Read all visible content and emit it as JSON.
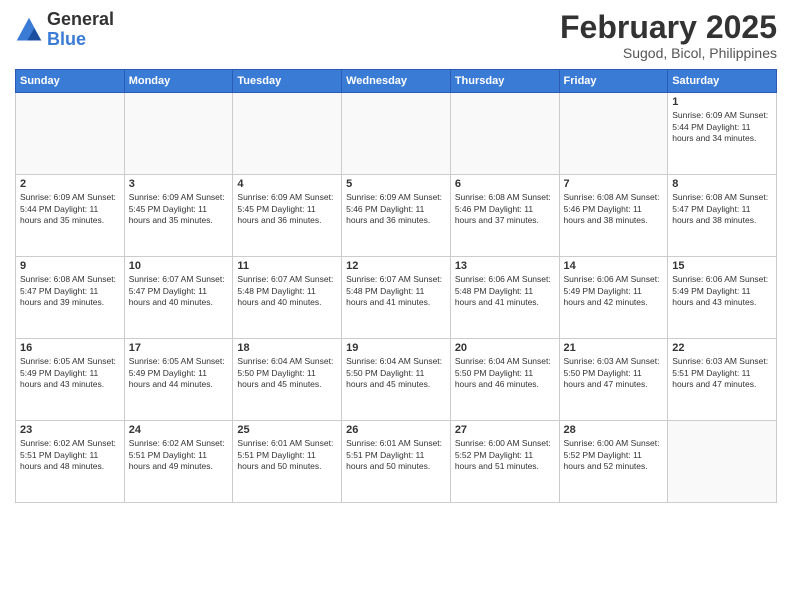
{
  "header": {
    "logo": {
      "general": "General",
      "blue": "Blue"
    },
    "title": "February 2025",
    "subtitle": "Sugod, Bicol, Philippines"
  },
  "days_of_week": [
    "Sunday",
    "Monday",
    "Tuesday",
    "Wednesday",
    "Thursday",
    "Friday",
    "Saturday"
  ],
  "weeks": [
    [
      {
        "day": "",
        "info": ""
      },
      {
        "day": "",
        "info": ""
      },
      {
        "day": "",
        "info": ""
      },
      {
        "day": "",
        "info": ""
      },
      {
        "day": "",
        "info": ""
      },
      {
        "day": "",
        "info": ""
      },
      {
        "day": "1",
        "info": "Sunrise: 6:09 AM\nSunset: 5:44 PM\nDaylight: 11 hours and 34 minutes."
      }
    ],
    [
      {
        "day": "2",
        "info": "Sunrise: 6:09 AM\nSunset: 5:44 PM\nDaylight: 11 hours and 35 minutes."
      },
      {
        "day": "3",
        "info": "Sunrise: 6:09 AM\nSunset: 5:45 PM\nDaylight: 11 hours and 35 minutes."
      },
      {
        "day": "4",
        "info": "Sunrise: 6:09 AM\nSunset: 5:45 PM\nDaylight: 11 hours and 36 minutes."
      },
      {
        "day": "5",
        "info": "Sunrise: 6:09 AM\nSunset: 5:46 PM\nDaylight: 11 hours and 36 minutes."
      },
      {
        "day": "6",
        "info": "Sunrise: 6:08 AM\nSunset: 5:46 PM\nDaylight: 11 hours and 37 minutes."
      },
      {
        "day": "7",
        "info": "Sunrise: 6:08 AM\nSunset: 5:46 PM\nDaylight: 11 hours and 38 minutes."
      },
      {
        "day": "8",
        "info": "Sunrise: 6:08 AM\nSunset: 5:47 PM\nDaylight: 11 hours and 38 minutes."
      }
    ],
    [
      {
        "day": "9",
        "info": "Sunrise: 6:08 AM\nSunset: 5:47 PM\nDaylight: 11 hours and 39 minutes."
      },
      {
        "day": "10",
        "info": "Sunrise: 6:07 AM\nSunset: 5:47 PM\nDaylight: 11 hours and 40 minutes."
      },
      {
        "day": "11",
        "info": "Sunrise: 6:07 AM\nSunset: 5:48 PM\nDaylight: 11 hours and 40 minutes."
      },
      {
        "day": "12",
        "info": "Sunrise: 6:07 AM\nSunset: 5:48 PM\nDaylight: 11 hours and 41 minutes."
      },
      {
        "day": "13",
        "info": "Sunrise: 6:06 AM\nSunset: 5:48 PM\nDaylight: 11 hours and 41 minutes."
      },
      {
        "day": "14",
        "info": "Sunrise: 6:06 AM\nSunset: 5:49 PM\nDaylight: 11 hours and 42 minutes."
      },
      {
        "day": "15",
        "info": "Sunrise: 6:06 AM\nSunset: 5:49 PM\nDaylight: 11 hours and 43 minutes."
      }
    ],
    [
      {
        "day": "16",
        "info": "Sunrise: 6:05 AM\nSunset: 5:49 PM\nDaylight: 11 hours and 43 minutes."
      },
      {
        "day": "17",
        "info": "Sunrise: 6:05 AM\nSunset: 5:49 PM\nDaylight: 11 hours and 44 minutes."
      },
      {
        "day": "18",
        "info": "Sunrise: 6:04 AM\nSunset: 5:50 PM\nDaylight: 11 hours and 45 minutes."
      },
      {
        "day": "19",
        "info": "Sunrise: 6:04 AM\nSunset: 5:50 PM\nDaylight: 11 hours and 45 minutes."
      },
      {
        "day": "20",
        "info": "Sunrise: 6:04 AM\nSunset: 5:50 PM\nDaylight: 11 hours and 46 minutes."
      },
      {
        "day": "21",
        "info": "Sunrise: 6:03 AM\nSunset: 5:50 PM\nDaylight: 11 hours and 47 minutes."
      },
      {
        "day": "22",
        "info": "Sunrise: 6:03 AM\nSunset: 5:51 PM\nDaylight: 11 hours and 47 minutes."
      }
    ],
    [
      {
        "day": "23",
        "info": "Sunrise: 6:02 AM\nSunset: 5:51 PM\nDaylight: 11 hours and 48 minutes."
      },
      {
        "day": "24",
        "info": "Sunrise: 6:02 AM\nSunset: 5:51 PM\nDaylight: 11 hours and 49 minutes."
      },
      {
        "day": "25",
        "info": "Sunrise: 6:01 AM\nSunset: 5:51 PM\nDaylight: 11 hours and 50 minutes."
      },
      {
        "day": "26",
        "info": "Sunrise: 6:01 AM\nSunset: 5:51 PM\nDaylight: 11 hours and 50 minutes."
      },
      {
        "day": "27",
        "info": "Sunrise: 6:00 AM\nSunset: 5:52 PM\nDaylight: 11 hours and 51 minutes."
      },
      {
        "day": "28",
        "info": "Sunrise: 6:00 AM\nSunset: 5:52 PM\nDaylight: 11 hours and 52 minutes."
      },
      {
        "day": "",
        "info": ""
      }
    ]
  ]
}
